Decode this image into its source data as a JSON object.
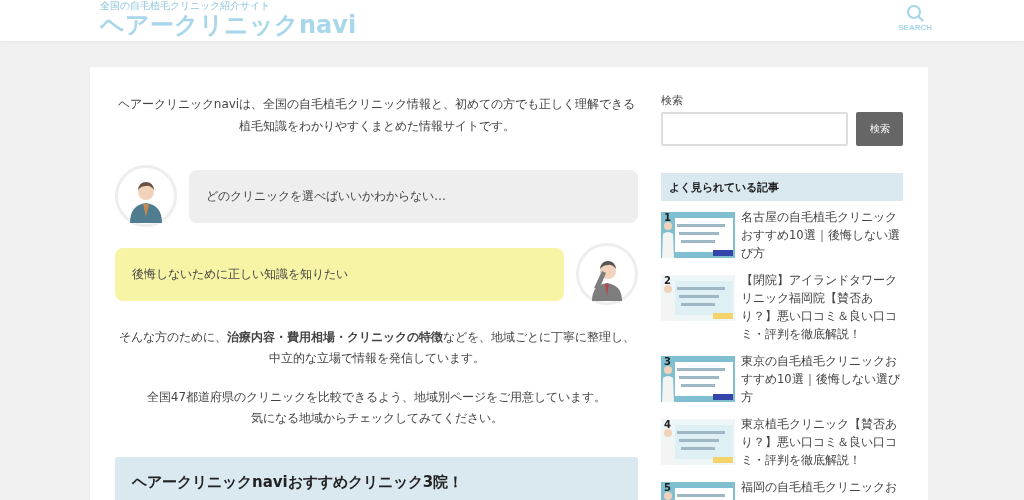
{
  "header": {
    "tagline": "全国の自毛植毛クリニック紹介サイト",
    "logo": "ヘアークリニックnavi",
    "search_label": "SEARCH"
  },
  "intro": "ヘアークリニックnaviは、全国の自毛植毛クリニック情報と、初めての方でも正しく理解できる植毛知識をわかりやすくまとめた情報サイトです。",
  "dialogue": [
    {
      "kind": "left",
      "text": "どのクリニックを選べばいいかわからない…"
    },
    {
      "kind": "right",
      "text": "後悔しないために正しい知識を知りたい"
    }
  ],
  "paragraphs": [
    [
      "そんな方のために、**治療内容・費用相場・クリニックの特徴**などを、地域ごとに丁寧に整理し、中立的な立場で情報を発信しています。"
    ],
    [
      "全国47都道府県のクリニックを比較できるよう、地域別ページをご用意しています。",
      "気になる地域からチェックしてみてください。"
    ]
  ],
  "section_heading": "ヘアークリニックnaviおすすめクリニック3院！",
  "sidebar": {
    "search_title": "検索",
    "search_button": "検索",
    "popular_title": "よく見られている記事",
    "articles": [
      {
        "rank": "1",
        "title": "名古屋の自毛植毛クリニックおすすめ10選｜後悔しない選び方"
      },
      {
        "rank": "2",
        "title": "【閉院】アイランドタワークリニック福岡院【賛否あり？】悪い口コミ＆良い口コミ・評判を徹底解説！"
      },
      {
        "rank": "3",
        "title": "東京の自毛植毛クリニックおすすめ10選｜後悔しない選び方"
      },
      {
        "rank": "4",
        "title": "東京植毛クリニック【賛否あり？】悪い口コミ＆良い口コミ・評判を徹底解説！"
      },
      {
        "rank": "5",
        "title": "福岡の自毛植毛クリニックお"
      }
    ]
  }
}
